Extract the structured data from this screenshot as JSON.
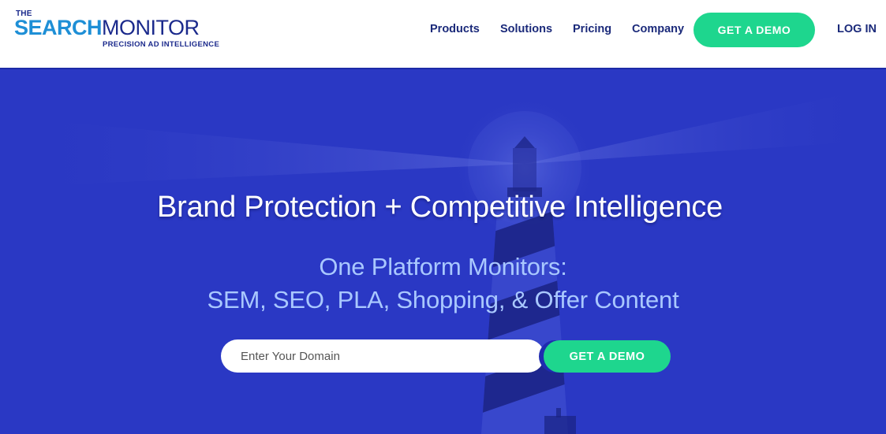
{
  "brand": {
    "the": "THE",
    "search": "SEARCH",
    "monitor": "MONITOR",
    "tagline": "PRECISION AD INTELLIGENCE"
  },
  "nav": {
    "items": [
      {
        "label": "Products"
      },
      {
        "label": "Solutions"
      },
      {
        "label": "Pricing"
      },
      {
        "label": "Company"
      }
    ],
    "demo_label": "GET A DEMO",
    "login_label": "LOG IN"
  },
  "hero": {
    "title": "Brand Protection + Competitive Intelligence",
    "subtitle_line1": "One Platform Monitors:",
    "subtitle_line2": "SEM, SEO, PLA, Shopping, & Offer Content",
    "domain_placeholder": "Enter Your Domain",
    "demo_label": "GET A DEMO"
  },
  "colors": {
    "accent_green": "#1ed68e",
    "hero_blue": "#2a38c4",
    "nav_text": "#1b2a7a",
    "logo_light_blue": "#1e8fd6"
  }
}
